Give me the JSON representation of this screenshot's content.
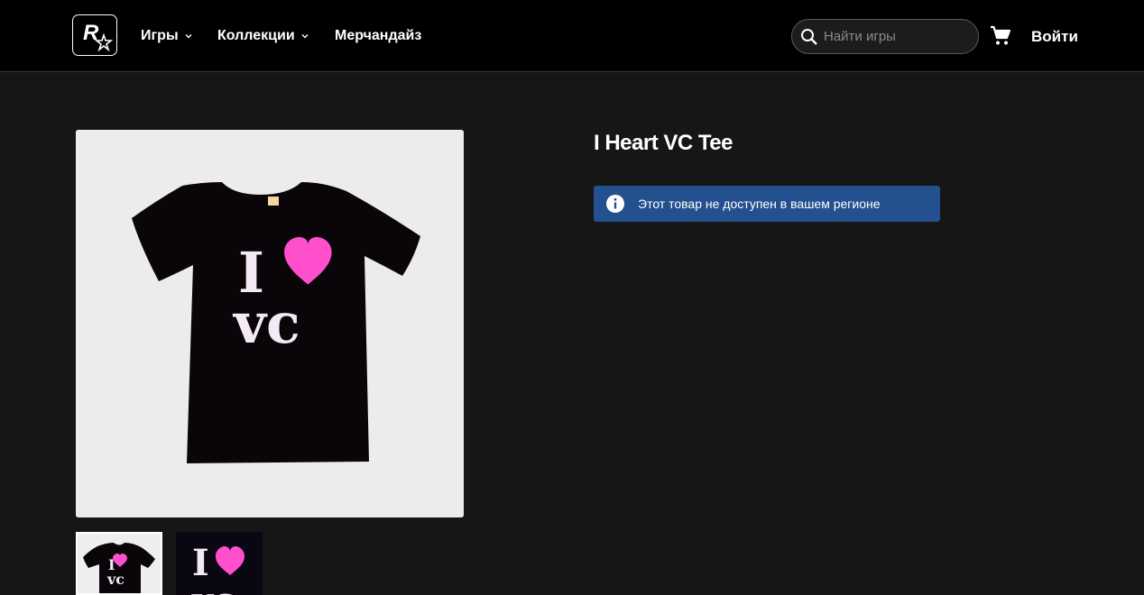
{
  "header": {
    "logo_alt": "Rockstar Games",
    "nav": [
      {
        "label": "Игры",
        "has_dropdown": true
      },
      {
        "label": "Коллекции",
        "has_dropdown": true
      },
      {
        "label": "Мерчандайз",
        "has_dropdown": false
      }
    ],
    "search": {
      "placeholder": "Найти игры",
      "value": ""
    },
    "login_label": "Войти"
  },
  "product": {
    "title": "I Heart VC Tee",
    "availability_notice": "Этот товар не доступен в вашем регионе",
    "notice_color": "#23508f",
    "shirt_print": {
      "line1": "I",
      "line2": "VC"
    },
    "heart_color": "#ff4fcd",
    "thumbnails": [
      "tee-front",
      "tee-print-closeup"
    ],
    "selected_thumbnail": 0
  },
  "icons": {
    "search": "search-icon",
    "cart": "cart-icon",
    "info": "info-icon",
    "chevron": "chevron-down-icon"
  }
}
